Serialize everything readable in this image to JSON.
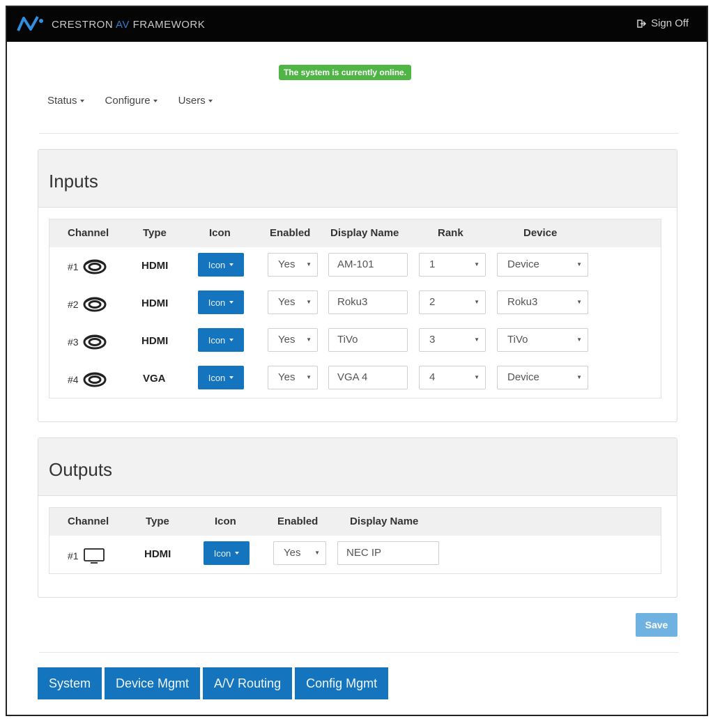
{
  "header": {
    "brand_prefix": "CRESTRON ",
    "brand_av": "AV",
    "brand_suffix": " FRAMEWORK",
    "signoff": "Sign Off"
  },
  "status_banner": "The system is currently online.",
  "menu": [
    "Status",
    "Configure",
    "Users"
  ],
  "inputs": {
    "title": "Inputs",
    "columns": [
      "Channel",
      "Type",
      "Icon",
      "Enabled",
      "Display Name",
      "Rank",
      "Device"
    ],
    "rows": [
      {
        "channel": "#1",
        "type": "HDMI",
        "icon_button": "Icon",
        "enabled": "Yes",
        "display_name": "AM-101",
        "rank": "1",
        "device": "Device"
      },
      {
        "channel": "#2",
        "type": "HDMI",
        "icon_button": "Icon",
        "enabled": "Yes",
        "display_name": "Roku3",
        "rank": "2",
        "device": "Roku3"
      },
      {
        "channel": "#3",
        "type": "HDMI",
        "icon_button": "Icon",
        "enabled": "Yes",
        "display_name": "TiVo",
        "rank": "3",
        "device": "TiVo"
      },
      {
        "channel": "#4",
        "type": "VGA",
        "icon_button": "Icon",
        "enabled": "Yes",
        "display_name": "VGA 4",
        "rank": "4",
        "device": "Device"
      }
    ]
  },
  "outputs": {
    "title": "Outputs",
    "columns": [
      "Channel",
      "Type",
      "Icon",
      "Enabled",
      "Display Name"
    ],
    "rows": [
      {
        "channel": "#1",
        "type": "HDMI",
        "icon_button": "Icon",
        "enabled": "Yes",
        "display_name": "NEC IP"
      }
    ]
  },
  "save_label": "Save",
  "bottom_nav": [
    "System",
    "Device Mgmt",
    "A/V Routing",
    "Config Mgmt"
  ],
  "colors": {
    "primary": "#1474bd",
    "online": "#4fb545",
    "save": "#6fb1e0",
    "topbar": "#050505"
  }
}
